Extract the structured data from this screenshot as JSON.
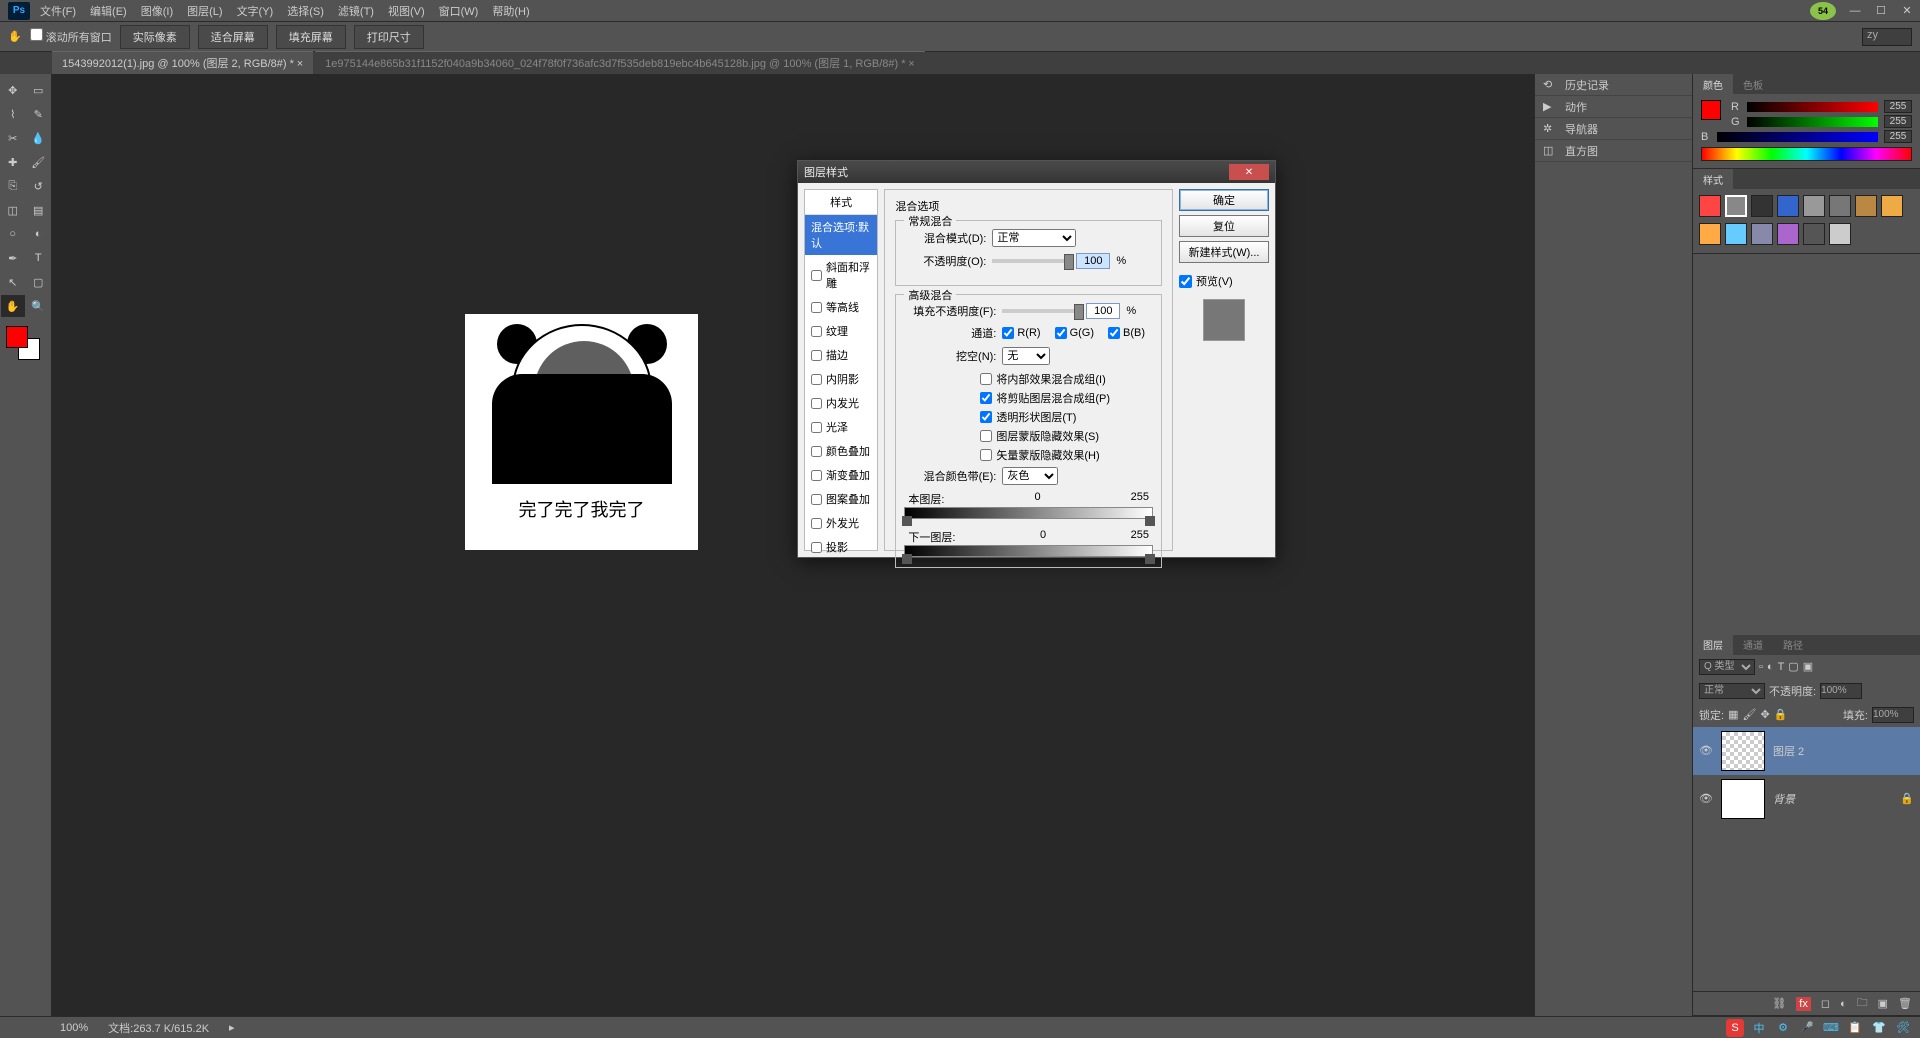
{
  "menubar": [
    "文件(F)",
    "编辑(E)",
    "图像(I)",
    "图层(L)",
    "文字(Y)",
    "选择(S)",
    "滤镜(T)",
    "视图(V)",
    "窗口(W)",
    "帮助(H)"
  ],
  "badge": "54",
  "optionbar": {
    "tool_hint": "✋",
    "scroll_all": "滚动所有窗口",
    "btns": [
      "实际像素",
      "适合屏幕",
      "填充屏幕",
      "打印尺寸"
    ],
    "workspace": "zy"
  },
  "tabs": [
    {
      "label": "1543992012(1).jpg @ 100% (图层 2, RGB/8#) *",
      "active": true
    },
    {
      "label": "1e975144e865b31f1152f040a9b34060_024f78f0f736afc3d7f535deb819ebc4b645128b.jpg @ 100% (图层 1, RGB/8#) *",
      "active": false
    }
  ],
  "meme_text": "完了完了我完了",
  "statusbar": {
    "zoom": "100%",
    "doc": "文档:263.7 K/615.2K"
  },
  "panels_collapsed": [
    "历史记录",
    "动作",
    "导航器",
    "直方图"
  ],
  "color_panel": {
    "tabs": [
      "颜色",
      "色板"
    ],
    "R": "255",
    "G": "255",
    "B": "255"
  },
  "styles_panel": {
    "tab": "样式"
  },
  "layers_panel": {
    "tabs": [
      "图层",
      "通道",
      "路径"
    ],
    "kind": "Q 类型",
    "mode": "正常",
    "opacity_label": "不透明度:",
    "opacity": "100%",
    "lock_label": "锁定:",
    "fill_label": "填充:",
    "fill": "100%",
    "layers": [
      {
        "name": "图层 2",
        "selected": true,
        "bg": false
      },
      {
        "name": "背景",
        "selected": false,
        "bg": true
      }
    ]
  },
  "dialog": {
    "title": "图层样式",
    "left_header": "样式",
    "items": [
      {
        "label": "混合选项:默认",
        "sel": true,
        "chk": null
      },
      {
        "label": "斜面和浮雕",
        "chk": false
      },
      {
        "label": "等高线",
        "chk": false
      },
      {
        "label": "纹理",
        "chk": false
      },
      {
        "label": "描边",
        "chk": false
      },
      {
        "label": "内阴影",
        "chk": false
      },
      {
        "label": "内发光",
        "chk": false
      },
      {
        "label": "光泽",
        "chk": false
      },
      {
        "label": "颜色叠加",
        "chk": false
      },
      {
        "label": "渐变叠加",
        "chk": false
      },
      {
        "label": "图案叠加",
        "chk": false
      },
      {
        "label": "外发光",
        "chk": false
      },
      {
        "label": "投影",
        "chk": false
      }
    ],
    "section_title": "混合选项",
    "general": {
      "title": "常规混合",
      "mode_label": "混合模式(D):",
      "mode": "正常",
      "opacity_label": "不透明度(O):",
      "opacity": "100",
      "pct": "%"
    },
    "advanced": {
      "title": "高级混合",
      "fill_label": "填充不透明度(F):",
      "fill": "100",
      "pct": "%",
      "channels_label": "通道:",
      "R": "R(R)",
      "G": "G(G)",
      "B": "B(B)",
      "knockout_label": "挖空(N):",
      "knockout": "无",
      "chk1": "将内部效果混合成组(I)",
      "chk1v": false,
      "chk2": "将剪贴图层混合成组(P)",
      "chk2v": true,
      "chk3": "透明形状图层(T)",
      "chk3v": true,
      "chk4": "图层蒙版隐藏效果(S)",
      "chk4v": false,
      "chk5": "矢量蒙版隐藏效果(H)",
      "chk5v": false
    },
    "blendif": {
      "label": "混合颜色带(E):",
      "value": "灰色",
      "this_label": "本图层:",
      "this_lo": "0",
      "this_hi": "255",
      "under_label": "下一图层:",
      "under_lo": "0",
      "under_hi": "255"
    },
    "buttons": {
      "ok": "确定",
      "cancel": "复位",
      "new_style": "新建样式(W)...",
      "preview": "预览(V)"
    }
  }
}
